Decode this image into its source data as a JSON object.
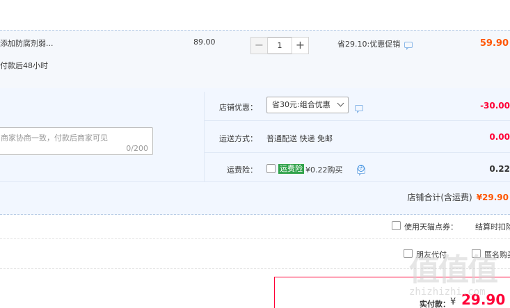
{
  "item": {
    "title": "添加防腐剂弱...",
    "note": "付款后48小时",
    "unit_price": "89.00",
    "quantity": "1",
    "minus_label": "−",
    "plus_label": "+",
    "promo": "省29.10:优惠促销",
    "subtotal": "59.90"
  },
  "shop": {
    "memo_placeholder": "商家协商一致，付款后商家可见",
    "memo_count": "0/200",
    "discount_label": "店铺优惠：",
    "discount_select": "省30元:组合优惠",
    "discount_value": "-30.00",
    "shipping_label": "运送方式：",
    "shipping_method": "普通配送 快递 免邮",
    "shipping_value": "0.00",
    "insurance_label": "运费险：",
    "insurance_tag": "运费险",
    "insurance_text": "¥0.22购买",
    "insurance_value": "0.22",
    "total_label": "店铺合计(含运费)",
    "total_value": "¥29.90"
  },
  "coupon": {
    "label": "使用天猫点券：",
    "status": "结算时扣除"
  },
  "options": {
    "friend_pay": "朋友代付",
    "anonymous": "匿名购买"
  },
  "payment": {
    "label": "实付款：",
    "currency": "¥",
    "amount": "29.90"
  },
  "watermark": {
    "logo": "值值值",
    "site": "zhizhizhi.com"
  },
  "colors": {
    "accent_red": "#ff0036",
    "price_orange": "#ff5500",
    "tag_green": "#2fa24a",
    "panel_bg": "#f2f7ff"
  }
}
